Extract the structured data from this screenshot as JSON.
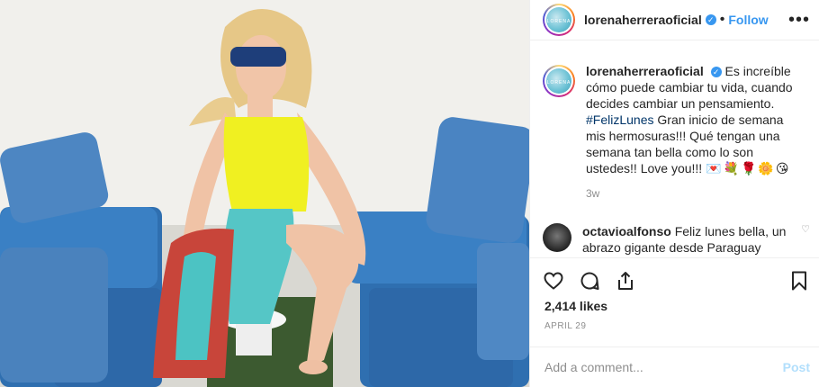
{
  "header": {
    "username": "lorenaherreraoficial",
    "separator": "•",
    "follow_label": "Follow",
    "more_label": "•••"
  },
  "caption": {
    "username": "lorenaherreraoficial",
    "text_before": "Es increíble cómo puede cambiar tu vida, cuando decides cambiar un pensamiento.",
    "hashtag": "#FelizLunes",
    "text_after": "Gran inicio de semana mis hermosuras!!! Qué tengan una semana tan bella como lo son ustedes!! Love you!!!",
    "emojis": "💌💐🌹🌼😘",
    "time_ago": "3w"
  },
  "comment": {
    "username": "octavioalfonso",
    "text": "Feliz lunes bella, un abrazo gigante desde Paraguay"
  },
  "stats": {
    "likes": "2,414 likes",
    "date": "APRIL 29"
  },
  "add_comment": {
    "placeholder": "Add a comment...",
    "post_label": "Post"
  },
  "icons": [
    "heart-icon",
    "comment-icon",
    "share-icon",
    "bookmark-icon",
    "verified-badge-icon"
  ],
  "colors": {
    "link": "#3897f0",
    "post_disabled": "#b2dffc",
    "muted": "#8e8e8e"
  }
}
